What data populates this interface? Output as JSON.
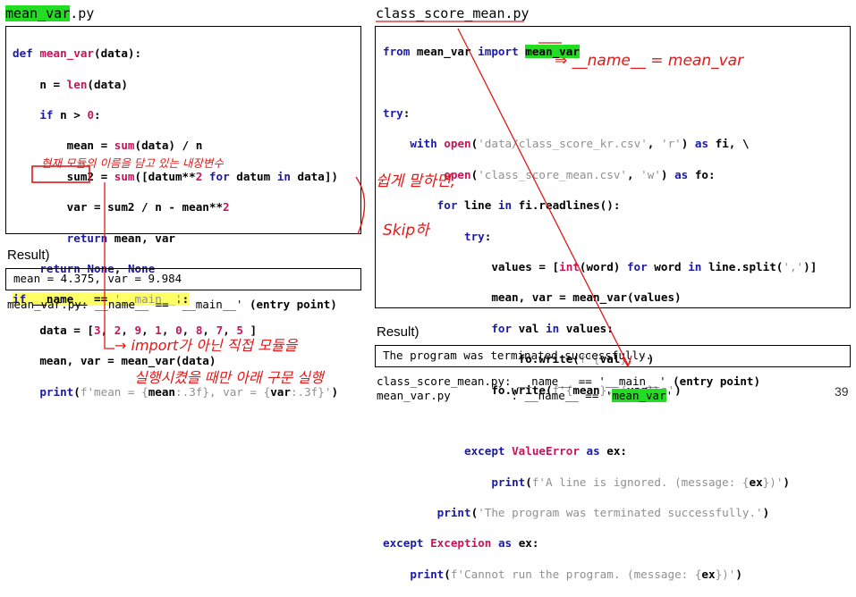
{
  "left": {
    "file_title_hl": "mean_var",
    "file_title_ext": ".py",
    "result_label": "Result)",
    "result_output": "mean = 4.375, var = 9.984",
    "note_prefix": "mean_var.py: __name__ == '__main__' ",
    "note_suffix": "(entry point)"
  },
  "right": {
    "file_title": "class_score_mean.py",
    "result_label": "Result)",
    "result_output": "The program was terminated successfully.",
    "note1_prefix": "class_score_mean.py: __name__ == '__main__' ",
    "note1_suffix": "(entry point)",
    "note2_prefix": "mean_var.py         : __name__ == '",
    "note2_hl": "mean_var",
    "note2_suffix": "'"
  },
  "annotations": {
    "name_eq": "⇒ __name__ = mean_var",
    "current_module": "현재 모듈의 이름을 담고 있는 내장변수",
    "simply_put": "쉽게 말하면,",
    "skip": "Skip하",
    "import_note_line1": "→ import가 아닌 직접 모듈을",
    "import_note_line2": "실행시켰을 때만 아래 구문 실행"
  },
  "page_number": "39",
  "colors": {
    "highlight_green": "#22dd22",
    "keyword_blue": "#1a1aa6",
    "builtin_magenta": "#c8145a",
    "annotation_red": "#e01818"
  }
}
